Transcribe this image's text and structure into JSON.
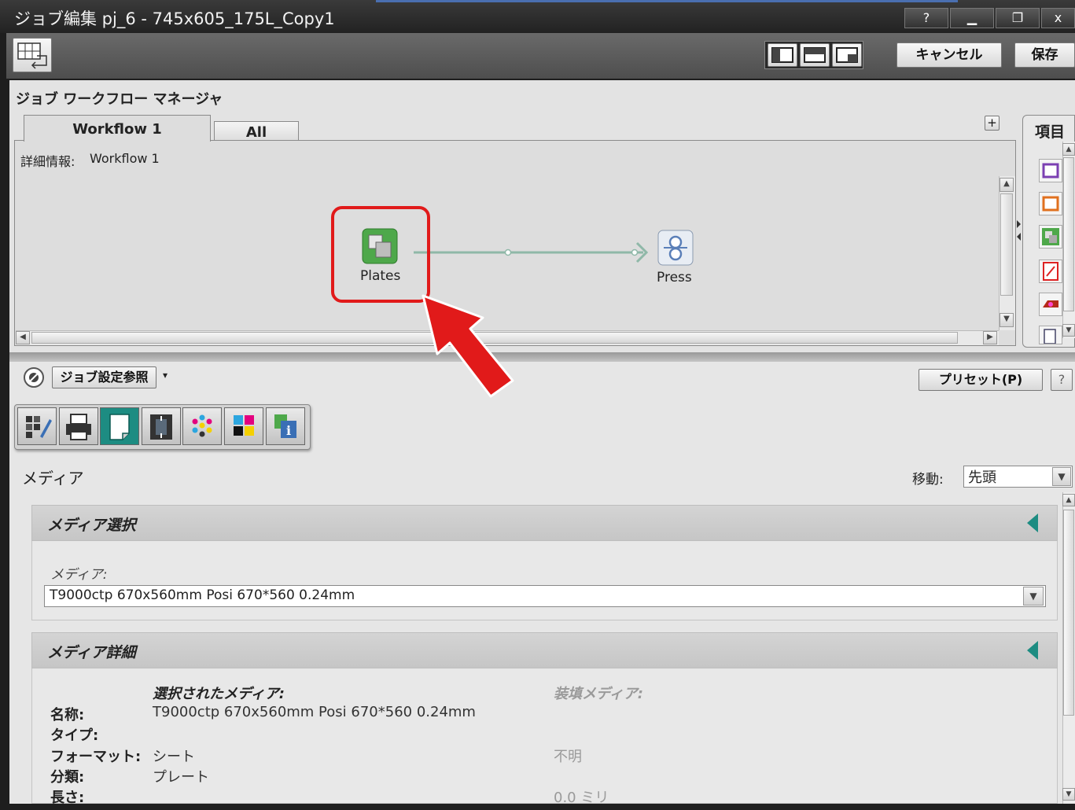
{
  "window": {
    "title": "ジョブ編集 pj_6 - 745x605_175L_Copy1",
    "help_label": "?",
    "minimize_label": "▁",
    "restore_label": "❐",
    "close_label": "x"
  },
  "toolbar": {
    "cancel_label": "キャンセル",
    "save_label": "保存"
  },
  "workflow_manager": {
    "title": "ジョブ ワークフロー マネージャ",
    "tabs": [
      {
        "label": "Workflow 1",
        "active": true
      },
      {
        "label": "All",
        "active": false
      }
    ],
    "details_label": "詳細情報:",
    "details_value": "Workflow 1",
    "add_label": "+",
    "nodes": [
      {
        "label": "Plates",
        "icon": "plates-icon",
        "color": "#4ea84a"
      },
      {
        "label": "Press",
        "icon": "press-icon",
        "color": "#5a7fb8"
      }
    ],
    "highlight_color": "#e11a1a"
  },
  "palette": {
    "title": "項目"
  },
  "settings": {
    "reference_label": "ジョブ設定参照",
    "preset_label": "プリセット(P)",
    "help_label": "?",
    "category_icons": [
      "imposition-edit-icon",
      "printer-icon",
      "media-icon",
      "marks-icon",
      "color-dots-icon",
      "cmyk-icon",
      "info-icon"
    ],
    "active_category": 2,
    "section_title": "メディア",
    "move_label": "移動:",
    "move_value": "先頭"
  },
  "media_selection": {
    "title": "メディア選択",
    "field_label": "メディア:",
    "field_value": "T9000ctp 670x560mm Posi 670*560 0.24mm"
  },
  "media_details": {
    "title": "メディア詳細",
    "col_selected": "選択されたメディア:",
    "col_loaded": "装填メディア:",
    "rows": [
      {
        "label": "名称:",
        "selected": "T9000ctp 670x560mm Posi 670*560 0.24mm",
        "loaded": ""
      },
      {
        "label": "タイプ:",
        "selected": "",
        "loaded": ""
      },
      {
        "label": "フォーマット:",
        "selected": "シート",
        "loaded": "不明"
      },
      {
        "label": "分類:",
        "selected": "プレート",
        "loaded": ""
      },
      {
        "label": "長さ:",
        "selected": "",
        "loaded": "0.0 ミリ"
      }
    ]
  },
  "colors": {
    "accent_teal": "#1d8c82",
    "annotation_red": "#e11a1a"
  }
}
